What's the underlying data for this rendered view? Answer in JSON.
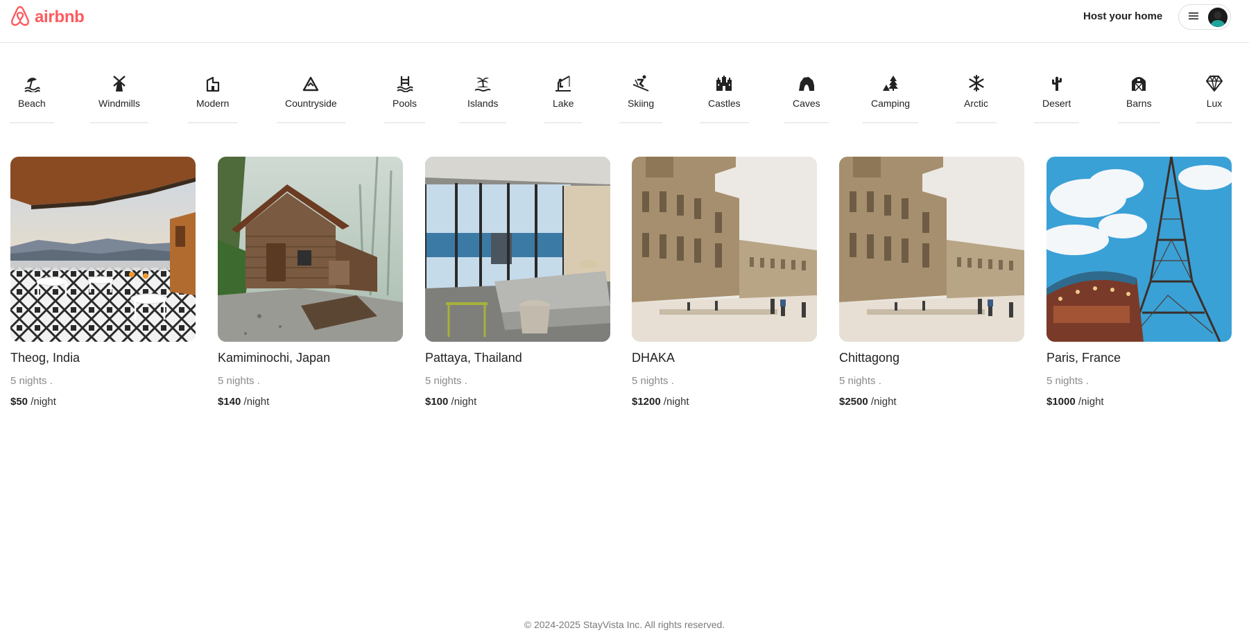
{
  "brand": {
    "name": "airbnb",
    "color": "#FF5A5F"
  },
  "header": {
    "host_label": "Host your home",
    "menu_icon": "hamburger-icon",
    "avatar_icon": "user-avatar"
  },
  "categories": [
    {
      "label": "Beach",
      "icon": "beach-icon"
    },
    {
      "label": "Windmills",
      "icon": "windmill-icon"
    },
    {
      "label": "Modern",
      "icon": "modern-house-icon"
    },
    {
      "label": "Countryside",
      "icon": "mountain-icon"
    },
    {
      "label": "Pools",
      "icon": "pool-icon"
    },
    {
      "label": "Islands",
      "icon": "island-icon"
    },
    {
      "label": "Lake",
      "icon": "fishing-icon"
    },
    {
      "label": "Skiing",
      "icon": "skiing-icon"
    },
    {
      "label": "Castles",
      "icon": "castle-icon"
    },
    {
      "label": "Caves",
      "icon": "cave-icon"
    },
    {
      "label": "Camping",
      "icon": "camping-icon"
    },
    {
      "label": "Arctic",
      "icon": "snowflake-icon"
    },
    {
      "label": "Desert",
      "icon": "cactus-icon"
    },
    {
      "label": "Barns",
      "icon": "barn-icon"
    },
    {
      "label": "Lux",
      "icon": "diamond-icon"
    }
  ],
  "listings": [
    {
      "title": "Theog, India",
      "nights": "5 nights .",
      "price": "$50",
      "unit": "/night",
      "photo": "terrace-mountain-view-photo"
    },
    {
      "title": "Kamiminochi, Japan",
      "nights": "5 nights .",
      "price": "$140",
      "unit": "/night",
      "photo": "wooden-cabin-forest-photo"
    },
    {
      "title": "Pattaya, Thailand",
      "nights": "5 nights .",
      "price": "$100",
      "unit": "/night",
      "photo": "glass-living-room-sea-photo"
    },
    {
      "title": "DHAKA",
      "nights": "5 nights .",
      "price": "$1200",
      "unit": "/night",
      "photo": "palace-courtyard-photo"
    },
    {
      "title": "Chittagong",
      "nights": "5 nights .",
      "price": "$2500",
      "unit": "/night",
      "photo": "palace-courtyard-photo"
    },
    {
      "title": "Paris, France",
      "nights": "5 nights .",
      "price": "$1000",
      "unit": "/night",
      "photo": "eiffel-tower-photo"
    }
  ],
  "footer": {
    "copyright": "© 2024-2025 StayVista Inc. All rights reserved."
  }
}
